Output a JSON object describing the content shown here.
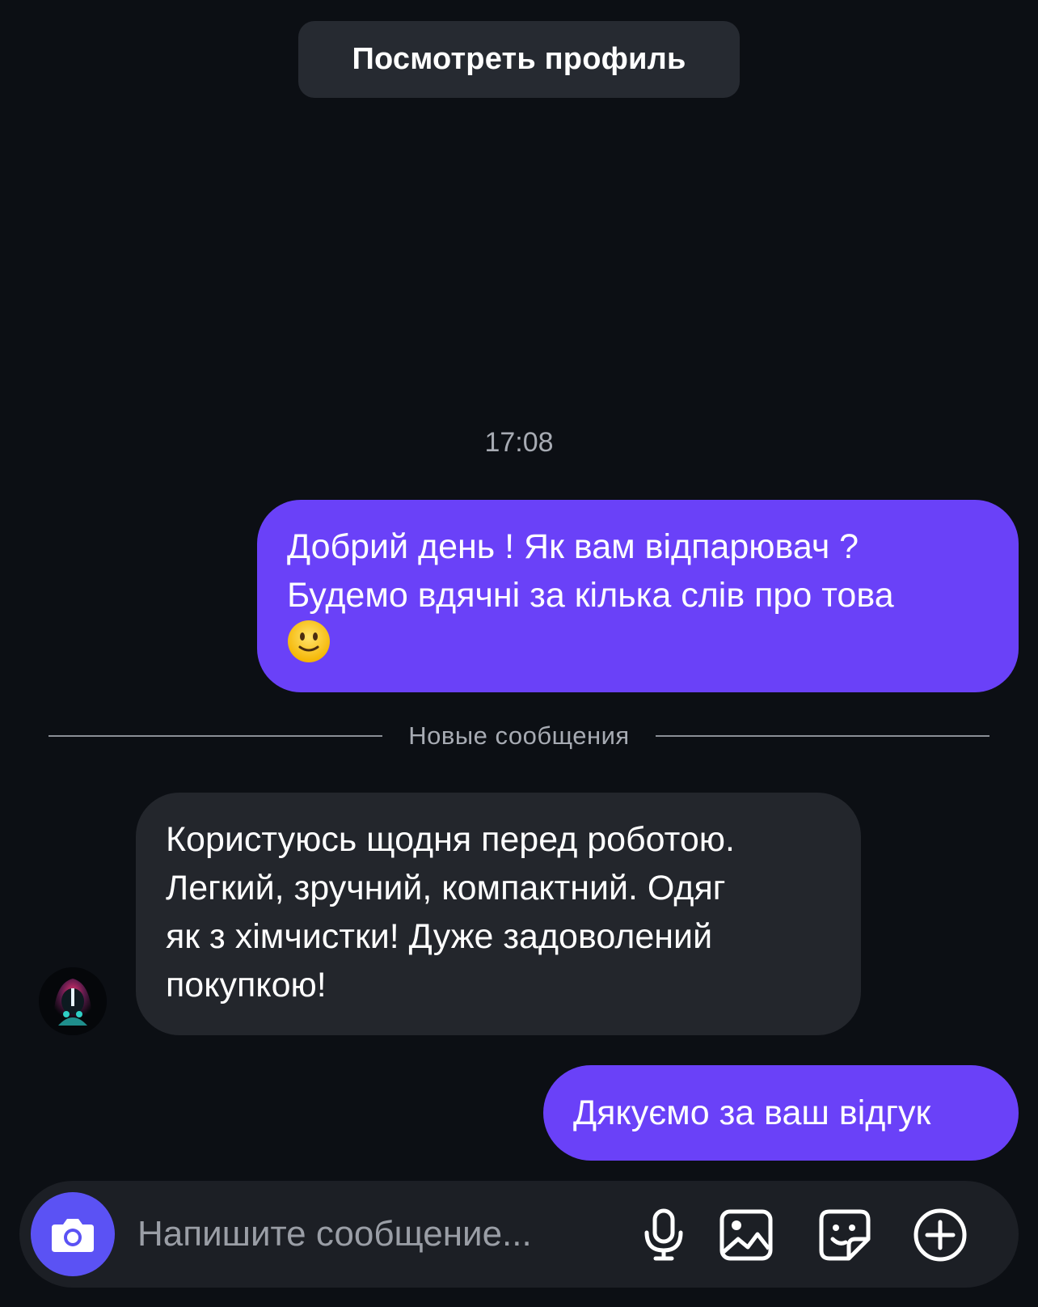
{
  "header": {
    "view_profile_label": "Посмотреть профиль"
  },
  "conversation": {
    "timestamp": "17:08",
    "messages": [
      {
        "direction": "outgoing",
        "lines": [
          "Добрий день ! Як вам відпарювач ?",
          "Будемо вдячні за кілька слів про това"
        ],
        "emoji": "slightly-smiling-face-icon"
      },
      {
        "direction": "incoming",
        "lines": [
          "Користуюсь щодня перед роботою.",
          "Легкий, зручний, компактний. Одяг",
          "як з хімчистки! Дуже задоволений",
          "покупкою!"
        ]
      },
      {
        "direction": "outgoing",
        "lines": [
          "Дякуємо за ваш відгук"
        ]
      }
    ],
    "new_messages_divider": "Новые сообщения"
  },
  "composer": {
    "placeholder": "Напишите сообщение...",
    "icons": [
      "camera-icon",
      "microphone-icon",
      "gallery-icon",
      "sticker-icon",
      "plus-icon"
    ]
  },
  "colors": {
    "background": "#0c0f14",
    "outgoing_bubble": "#6a41f8",
    "outgoing_bubble_2": "#5b46f0",
    "incoming_bubble": "#23262c",
    "camera_button": "#5b52f4"
  }
}
